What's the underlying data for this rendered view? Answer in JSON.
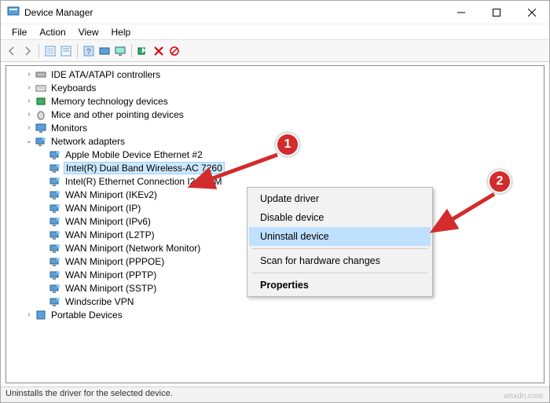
{
  "window": {
    "title": "Device Manager",
    "controls": {
      "minimize": "–",
      "maximize": "☐",
      "close": "✕"
    }
  },
  "menu": {
    "items": [
      "File",
      "Action",
      "View",
      "Help"
    ]
  },
  "toolbar": {
    "buttons": [
      {
        "name": "back-icon"
      },
      {
        "name": "forward-icon"
      },
      {
        "sep": true
      },
      {
        "name": "show-hidden-icon"
      },
      {
        "name": "properties-icon"
      },
      {
        "sep": true
      },
      {
        "name": "help-icon"
      },
      {
        "name": "scan-icon"
      },
      {
        "name": "monitor-icon"
      },
      {
        "sep": true
      },
      {
        "name": "update-driver-icon"
      },
      {
        "name": "uninstall-icon"
      },
      {
        "name": "disable-icon"
      }
    ]
  },
  "tree": {
    "nodes": [
      {
        "indent": 1,
        "arrow": ">",
        "icon": "ide",
        "label": "IDE ATA/ATAPI controllers"
      },
      {
        "indent": 1,
        "arrow": ">",
        "icon": "kb",
        "label": "Keyboards"
      },
      {
        "indent": 1,
        "arrow": ">",
        "icon": "mem",
        "label": "Memory technology devices"
      },
      {
        "indent": 1,
        "arrow": ">",
        "icon": "mouse",
        "label": "Mice and other pointing devices"
      },
      {
        "indent": 1,
        "arrow": ">",
        "icon": "mon",
        "label": "Monitors"
      },
      {
        "indent": 1,
        "arrow": "v",
        "icon": "net",
        "label": "Network adapters"
      },
      {
        "indent": 2,
        "arrow": "",
        "icon": "net",
        "label": "Apple Mobile Device Ethernet #2"
      },
      {
        "indent": 2,
        "arrow": "",
        "icon": "net",
        "label": "Intel(R) Dual Band Wireless-AC 7260",
        "selected": true
      },
      {
        "indent": 2,
        "arrow": "",
        "icon": "net",
        "label": "Intel(R) Ethernet Connection I217-LM"
      },
      {
        "indent": 2,
        "arrow": "",
        "icon": "net",
        "label": "WAN Miniport (IKEv2)"
      },
      {
        "indent": 2,
        "arrow": "",
        "icon": "net",
        "label": "WAN Miniport (IP)"
      },
      {
        "indent": 2,
        "arrow": "",
        "icon": "net",
        "label": "WAN Miniport (IPv6)"
      },
      {
        "indent": 2,
        "arrow": "",
        "icon": "net",
        "label": "WAN Miniport (L2TP)"
      },
      {
        "indent": 2,
        "arrow": "",
        "icon": "net",
        "label": "WAN Miniport (Network Monitor)"
      },
      {
        "indent": 2,
        "arrow": "",
        "icon": "net",
        "label": "WAN Miniport (PPPOE)"
      },
      {
        "indent": 2,
        "arrow": "",
        "icon": "net",
        "label": "WAN Miniport (PPTP)"
      },
      {
        "indent": 2,
        "arrow": "",
        "icon": "net",
        "label": "WAN Miniport (SSTP)"
      },
      {
        "indent": 2,
        "arrow": "",
        "icon": "net",
        "label": "Windscribe VPN"
      },
      {
        "indent": 1,
        "arrow": ">",
        "icon": "port",
        "label": "Portable Devices"
      }
    ]
  },
  "context_menu": {
    "items": [
      {
        "label": "Update driver"
      },
      {
        "label": "Disable device"
      },
      {
        "label": "Uninstall device",
        "highlight": true
      },
      {
        "sep": true
      },
      {
        "label": "Scan for hardware changes"
      },
      {
        "sep": true
      },
      {
        "label": "Properties",
        "bold": true
      }
    ]
  },
  "annotations": {
    "badge1": "1",
    "badge2": "2"
  },
  "statusbar": {
    "text": "Uninstalls the driver for the selected device."
  },
  "watermark": "wsxdn.com"
}
